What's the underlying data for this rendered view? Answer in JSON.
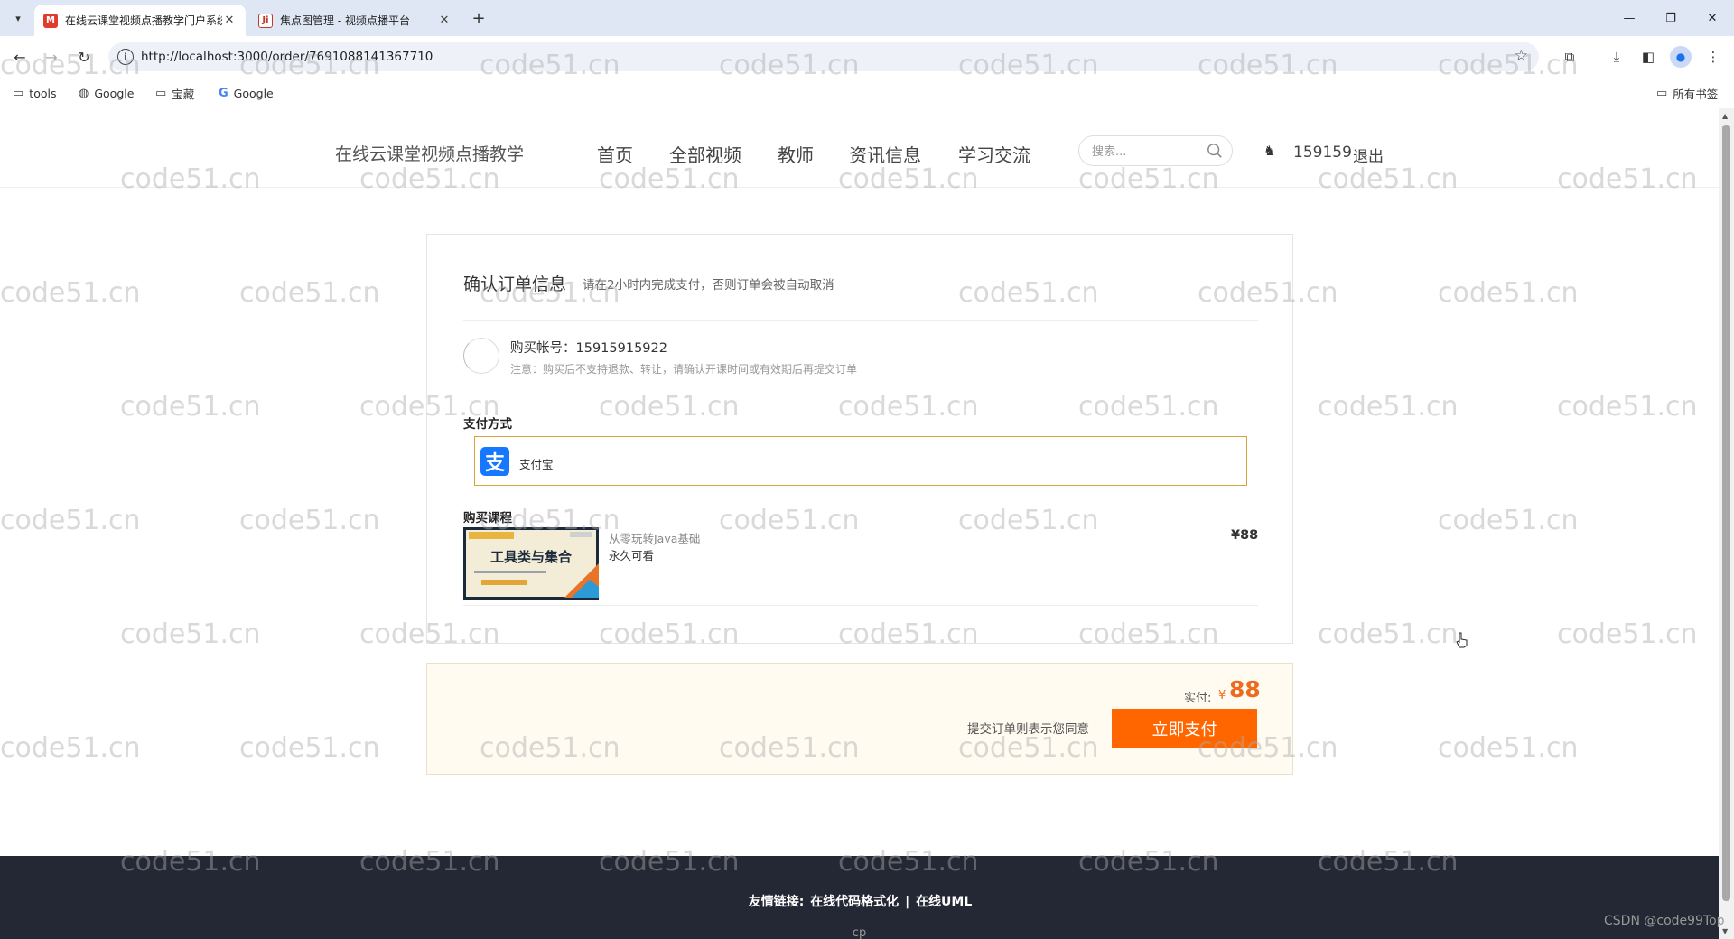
{
  "browser": {
    "tabs": [
      {
        "title": "在线云课堂视频点播教学门户系统",
        "favicon": "M",
        "active": true
      },
      {
        "title": "焦点图管理 - 视频点播平台",
        "favicon": "Ji",
        "active": false
      }
    ],
    "url": "http://localhost:3000/order/7691088141367710",
    "bookmarks": [
      {
        "label": "tools",
        "icon": "folder-icon"
      },
      {
        "label": "Google",
        "icon": "globe-icon"
      },
      {
        "label": "宝藏",
        "icon": "folder-icon"
      },
      {
        "label": "Google",
        "icon": "google-g-icon"
      }
    ],
    "all_bookmarks": "所有书签"
  },
  "header": {
    "brand": "在线云课堂视频点播教学",
    "nav": [
      "首页",
      "全部视频",
      "教师",
      "资讯信息",
      "学习交流"
    ],
    "search_placeholder": "搜索...",
    "username": "159159",
    "logout": "退出"
  },
  "order": {
    "title": "确认订单信息",
    "tip": "请在2小时内完成支付，否则订单会被自动取消",
    "account_label": "购买帐号：15915915922",
    "account_note": "注意：购买后不支持退款、转让，请确认开课时间或有效期后再提交订单",
    "payment_section": "支付方式",
    "payment_method": "支付宝",
    "course_section": "购买课程",
    "course": {
      "name": "从零玩转Java基础",
      "validity": "永久可看",
      "price": "¥88",
      "thumb_title": "工具类与集合"
    }
  },
  "pay_bar": {
    "paid_label": "实付:",
    "currency": "¥",
    "amount": "88",
    "agree_text": "提交订单则表示您同意",
    "pay_button": "立即支付"
  },
  "footer": {
    "links_label": "友情链接:",
    "links": [
      "在线代码格式化",
      "在线UML"
    ],
    "separator": "|",
    "cp": "cp"
  },
  "watermark_text": "code51.cn",
  "csdn_mark": "CSDN @code99Top",
  "colors": {
    "accent_orange": "#ff6600",
    "alipay_blue": "#1677ff",
    "footer_bg": "#242834",
    "pay_option_border": "#d5a43a"
  }
}
